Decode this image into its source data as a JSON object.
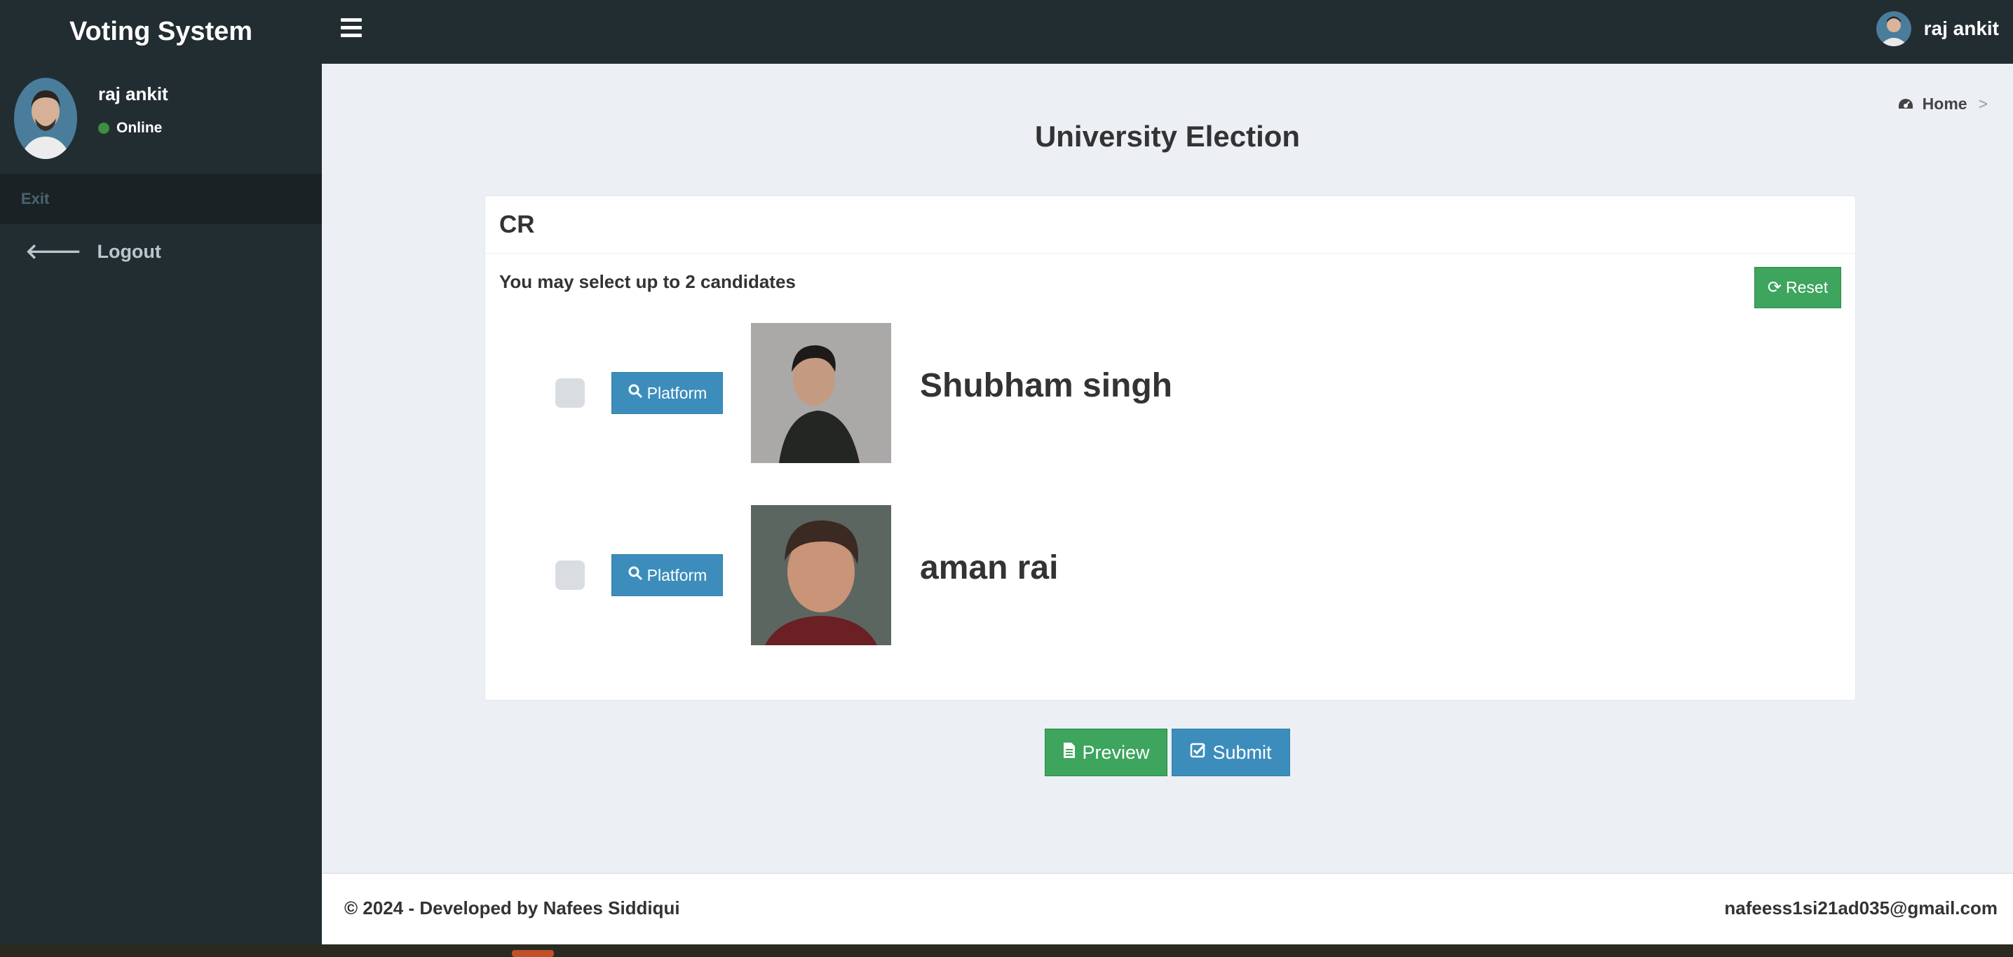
{
  "app": {
    "brand": "Voting System"
  },
  "header": {
    "user_name": "raj ankit"
  },
  "sidebar": {
    "user_name": "raj ankit",
    "status": "Online",
    "section_header": "Exit",
    "items": [
      {
        "label": "Logout",
        "icon": "arrow-left-icon"
      }
    ]
  },
  "breadcrumb": {
    "home": "Home",
    "separator": ">"
  },
  "page": {
    "title": "University Election"
  },
  "ballot": {
    "position": "CR",
    "instruction": "You may select up to 2 candidates",
    "reset_label": "Reset",
    "candidates": [
      {
        "name": "Shubham singh",
        "platform_label": "Platform",
        "checked": false
      },
      {
        "name": "aman rai",
        "platform_label": "Platform",
        "checked": false
      }
    ]
  },
  "actions": {
    "preview_label": "Preview",
    "submit_label": "Submit"
  },
  "footer": {
    "left": "© 2024 - Developed by Nafees Siddiqui",
    "right": "nafeess1si21ad035@gmail.com"
  },
  "colors": {
    "sidebar_bg": "#222d32",
    "content_bg": "#ecf0f5",
    "success": "#3da55d",
    "primary": "#3c8dbc",
    "online": "#3c8f3c"
  }
}
